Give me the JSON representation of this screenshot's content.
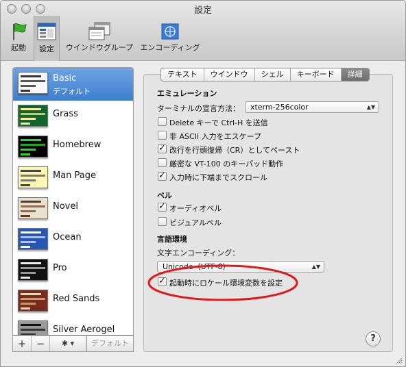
{
  "window": {
    "title": "設定"
  },
  "toolbar": {
    "items": [
      {
        "label": "起動",
        "icon": "green-flag-icon"
      },
      {
        "label": "設定",
        "icon": "settings-window-icon"
      },
      {
        "label": "ウインドウグループ",
        "icon": "window-group-icon"
      },
      {
        "label": "エンコーディング",
        "icon": "globe-flag-icon"
      }
    ]
  },
  "profiles": [
    {
      "name": "Basic",
      "sub": "デフォルト",
      "bg": "#f7f7f7",
      "fg": "#333333"
    },
    {
      "name": "Grass",
      "bg": "#12652c",
      "fg": "#ffe9a6"
    },
    {
      "name": "Homebrew",
      "bg": "#000000",
      "fg": "#27d827"
    },
    {
      "name": "Man Page",
      "bg": "#fdf7b2",
      "fg": "#444444"
    },
    {
      "name": "Novel",
      "bg": "#e9e1cb",
      "fg": "#5b3b26"
    },
    {
      "name": "Ocean",
      "bg": "#2a56b3",
      "fg": "#ffffff"
    },
    {
      "name": "Pro",
      "bg": "#111111",
      "fg": "#eeeeee"
    },
    {
      "name": "Red Sands",
      "bg": "#7a2b1f",
      "fg": "#e8d6b0"
    },
    {
      "name": "Silver Aerogel",
      "bg": "#9a9a9a",
      "fg": "#111111"
    }
  ],
  "list_footer": {
    "add": "+",
    "remove": "−",
    "gear": "✱ ▾",
    "default": "デフォルト"
  },
  "tabs": [
    "テキスト",
    "ウインドウ",
    "シェル",
    "キーボード",
    "詳細"
  ],
  "active_tab": "詳細",
  "emulation": {
    "heading": "エミュレーション",
    "declare_label": "ターミナルの宣言方法：",
    "declare_value": "xterm-256color",
    "options": [
      {
        "label": "Delete キーで Ctrl-H を送信",
        "checked": false
      },
      {
        "label": "非 ASCII 入力をエスケープ",
        "checked": false
      },
      {
        "label": "改行を行頭復帰（CR）としてペースト",
        "checked": true
      },
      {
        "label": "厳密な VT-100 のキーパッド動作",
        "checked": false
      },
      {
        "label": "入力時に下端までスクロール",
        "checked": true
      }
    ]
  },
  "bell": {
    "heading": "ベル",
    "options": [
      {
        "label": "オーディオベル",
        "checked": true
      },
      {
        "label": "ビジュアルベル",
        "checked": false
      }
    ]
  },
  "language": {
    "heading": "言語環境",
    "encoding_label": "文字エンコーディング：",
    "encoding_value": "Unicode（UTF-8）",
    "locale_option": {
      "label": "起動時にロケール環境変数を設定",
      "checked": true
    }
  },
  "help": "?",
  "annotation_color": "#e0191b",
  "accent": "#3f7ed0"
}
